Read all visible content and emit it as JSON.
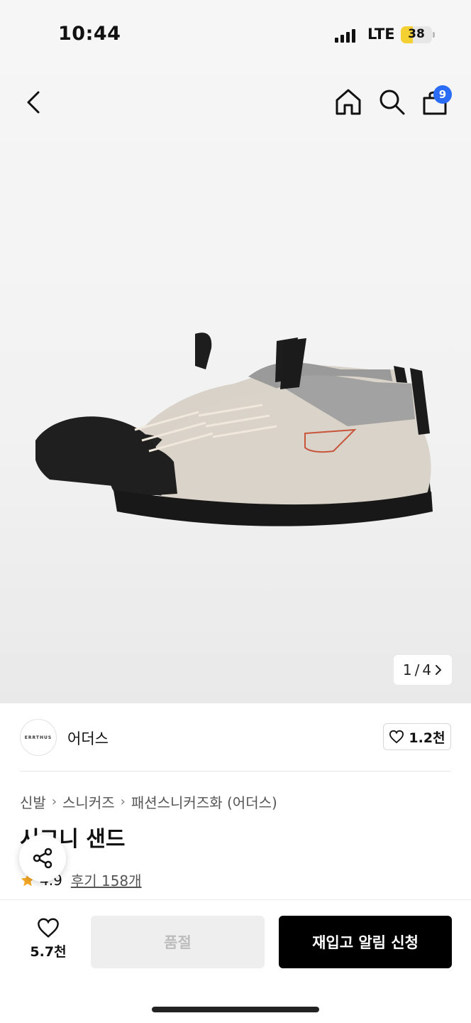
{
  "status_bar": {
    "time": "10:44",
    "network": "LTE",
    "battery": "38",
    "battery_level": 0.38
  },
  "nav": {
    "cart_count": "9"
  },
  "gallery": {
    "current": "1",
    "total": "4",
    "separator": "/"
  },
  "brand": {
    "logo_text": "ERRTHUS",
    "name": "어더스",
    "likes": "1.2천"
  },
  "breadcrumb": [
    "신발",
    "스니커즈",
    "패션스니커즈화 (어더스)"
  ],
  "product": {
    "title": "시그니 샌드",
    "rating": "4.9",
    "reviews": "후기 158개"
  },
  "bottom": {
    "wish_count": "5.7천",
    "soldout_label": "품절",
    "notify_label": "재입고 알림 신청"
  },
  "colors": {
    "accent_blue": "#2b6cf6",
    "battery_yellow": "#f5d033",
    "primary_black": "#000000",
    "star": "#f5a623"
  },
  "icons": [
    "back-icon",
    "home-icon",
    "search-icon",
    "bag-icon",
    "chevron-right-icon",
    "heart-icon",
    "star-icon",
    "share-icon"
  ]
}
